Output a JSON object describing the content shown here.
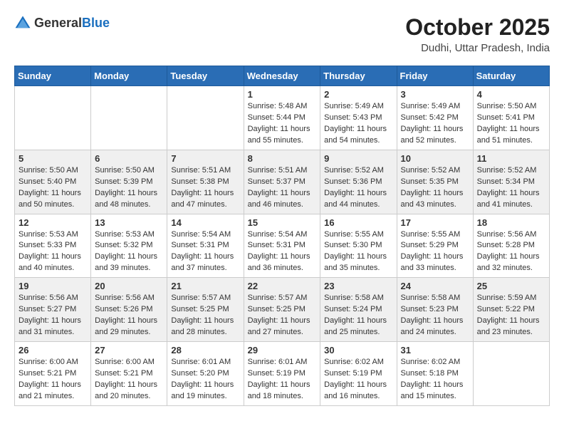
{
  "logo": {
    "general": "General",
    "blue": "Blue"
  },
  "header": {
    "month_year": "October 2025",
    "location": "Dudhi, Uttar Pradesh, India"
  },
  "days_of_week": [
    "Sunday",
    "Monday",
    "Tuesday",
    "Wednesday",
    "Thursday",
    "Friday",
    "Saturday"
  ],
  "weeks": [
    [
      {
        "day": "",
        "info": ""
      },
      {
        "day": "",
        "info": ""
      },
      {
        "day": "",
        "info": ""
      },
      {
        "day": "1",
        "info": "Sunrise: 5:48 AM\nSunset: 5:44 PM\nDaylight: 11 hours\nand 55 minutes."
      },
      {
        "day": "2",
        "info": "Sunrise: 5:49 AM\nSunset: 5:43 PM\nDaylight: 11 hours\nand 54 minutes."
      },
      {
        "day": "3",
        "info": "Sunrise: 5:49 AM\nSunset: 5:42 PM\nDaylight: 11 hours\nand 52 minutes."
      },
      {
        "day": "4",
        "info": "Sunrise: 5:50 AM\nSunset: 5:41 PM\nDaylight: 11 hours\nand 51 minutes."
      }
    ],
    [
      {
        "day": "5",
        "info": "Sunrise: 5:50 AM\nSunset: 5:40 PM\nDaylight: 11 hours\nand 50 minutes."
      },
      {
        "day": "6",
        "info": "Sunrise: 5:50 AM\nSunset: 5:39 PM\nDaylight: 11 hours\nand 48 minutes."
      },
      {
        "day": "7",
        "info": "Sunrise: 5:51 AM\nSunset: 5:38 PM\nDaylight: 11 hours\nand 47 minutes."
      },
      {
        "day": "8",
        "info": "Sunrise: 5:51 AM\nSunset: 5:37 PM\nDaylight: 11 hours\nand 46 minutes."
      },
      {
        "day": "9",
        "info": "Sunrise: 5:52 AM\nSunset: 5:36 PM\nDaylight: 11 hours\nand 44 minutes."
      },
      {
        "day": "10",
        "info": "Sunrise: 5:52 AM\nSunset: 5:35 PM\nDaylight: 11 hours\nand 43 minutes."
      },
      {
        "day": "11",
        "info": "Sunrise: 5:52 AM\nSunset: 5:34 PM\nDaylight: 11 hours\nand 41 minutes."
      }
    ],
    [
      {
        "day": "12",
        "info": "Sunrise: 5:53 AM\nSunset: 5:33 PM\nDaylight: 11 hours\nand 40 minutes."
      },
      {
        "day": "13",
        "info": "Sunrise: 5:53 AM\nSunset: 5:32 PM\nDaylight: 11 hours\nand 39 minutes."
      },
      {
        "day": "14",
        "info": "Sunrise: 5:54 AM\nSunset: 5:31 PM\nDaylight: 11 hours\nand 37 minutes."
      },
      {
        "day": "15",
        "info": "Sunrise: 5:54 AM\nSunset: 5:31 PM\nDaylight: 11 hours\nand 36 minutes."
      },
      {
        "day": "16",
        "info": "Sunrise: 5:55 AM\nSunset: 5:30 PM\nDaylight: 11 hours\nand 35 minutes."
      },
      {
        "day": "17",
        "info": "Sunrise: 5:55 AM\nSunset: 5:29 PM\nDaylight: 11 hours\nand 33 minutes."
      },
      {
        "day": "18",
        "info": "Sunrise: 5:56 AM\nSunset: 5:28 PM\nDaylight: 11 hours\nand 32 minutes."
      }
    ],
    [
      {
        "day": "19",
        "info": "Sunrise: 5:56 AM\nSunset: 5:27 PM\nDaylight: 11 hours\nand 31 minutes."
      },
      {
        "day": "20",
        "info": "Sunrise: 5:56 AM\nSunset: 5:26 PM\nDaylight: 11 hours\nand 29 minutes."
      },
      {
        "day": "21",
        "info": "Sunrise: 5:57 AM\nSunset: 5:25 PM\nDaylight: 11 hours\nand 28 minutes."
      },
      {
        "day": "22",
        "info": "Sunrise: 5:57 AM\nSunset: 5:25 PM\nDaylight: 11 hours\nand 27 minutes."
      },
      {
        "day": "23",
        "info": "Sunrise: 5:58 AM\nSunset: 5:24 PM\nDaylight: 11 hours\nand 25 minutes."
      },
      {
        "day": "24",
        "info": "Sunrise: 5:58 AM\nSunset: 5:23 PM\nDaylight: 11 hours\nand 24 minutes."
      },
      {
        "day": "25",
        "info": "Sunrise: 5:59 AM\nSunset: 5:22 PM\nDaylight: 11 hours\nand 23 minutes."
      }
    ],
    [
      {
        "day": "26",
        "info": "Sunrise: 6:00 AM\nSunset: 5:21 PM\nDaylight: 11 hours\nand 21 minutes."
      },
      {
        "day": "27",
        "info": "Sunrise: 6:00 AM\nSunset: 5:21 PM\nDaylight: 11 hours\nand 20 minutes."
      },
      {
        "day": "28",
        "info": "Sunrise: 6:01 AM\nSunset: 5:20 PM\nDaylight: 11 hours\nand 19 minutes."
      },
      {
        "day": "29",
        "info": "Sunrise: 6:01 AM\nSunset: 5:19 PM\nDaylight: 11 hours\nand 18 minutes."
      },
      {
        "day": "30",
        "info": "Sunrise: 6:02 AM\nSunset: 5:19 PM\nDaylight: 11 hours\nand 16 minutes."
      },
      {
        "day": "31",
        "info": "Sunrise: 6:02 AM\nSunset: 5:18 PM\nDaylight: 11 hours\nand 15 minutes."
      },
      {
        "day": "",
        "info": ""
      }
    ]
  ]
}
